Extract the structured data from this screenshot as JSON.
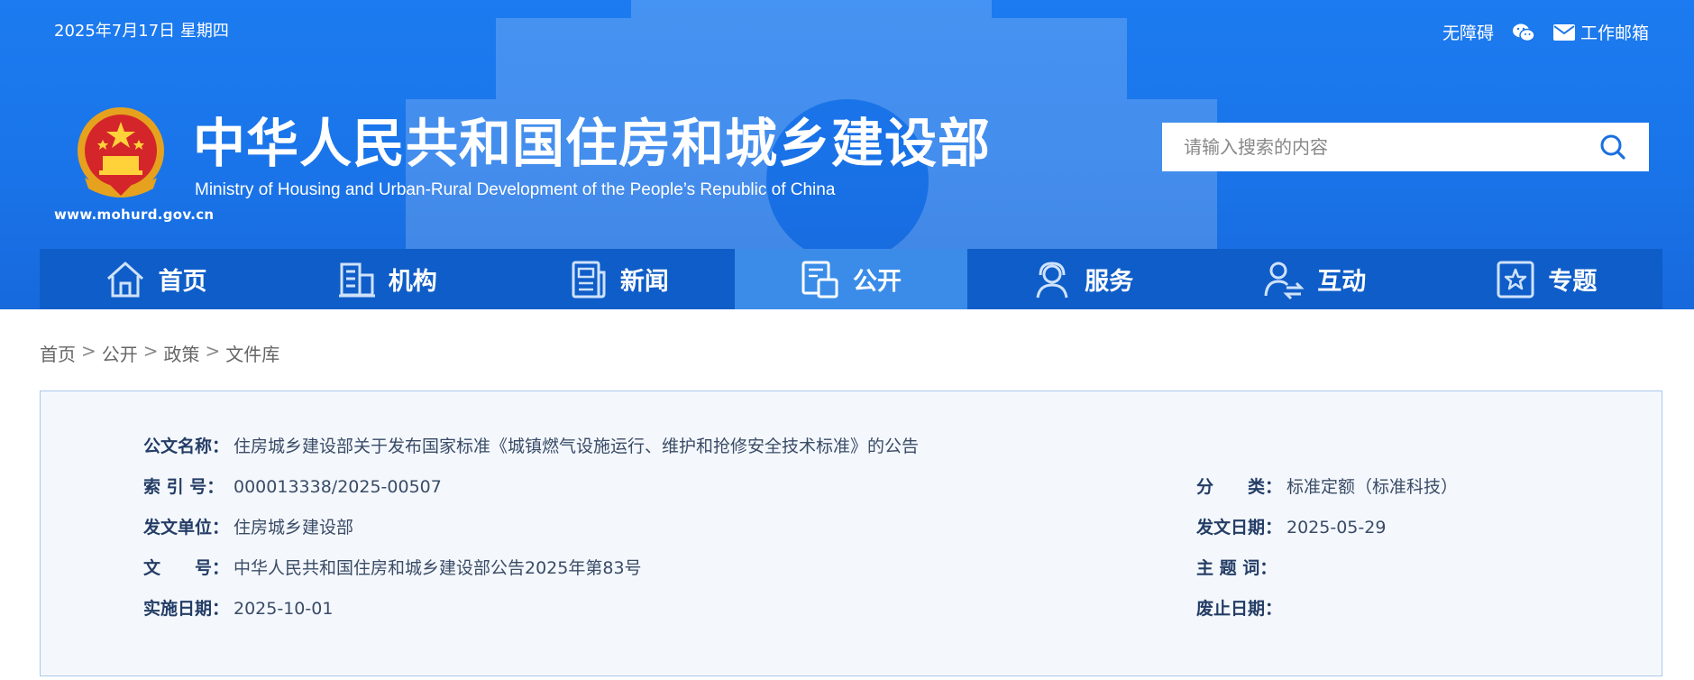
{
  "header": {
    "date": "2025年7月17日 星期四",
    "accessibility_label": "无障碍",
    "mail_label": "工作邮箱",
    "title_cn": "中华人民共和国住房和城乡建设部",
    "title_en": "Ministry of Housing and Urban-Rural Development of the People’s Republic of China",
    "domain": "www.mohurd.gov.cn",
    "search_placeholder": "请输入搜索的内容"
  },
  "nav": {
    "items": [
      {
        "label": "首页",
        "icon": "home-icon"
      },
      {
        "label": "机构",
        "icon": "building-icon"
      },
      {
        "label": "新闻",
        "icon": "newspaper-icon"
      },
      {
        "label": "公开",
        "icon": "document-icon",
        "active": true
      },
      {
        "label": "服务",
        "icon": "service-agent-icon"
      },
      {
        "label": "互动",
        "icon": "interaction-icon"
      },
      {
        "label": "专题",
        "icon": "star-topic-icon"
      }
    ]
  },
  "breadcrumb": [
    "首页",
    "公开",
    "政策",
    "文件库"
  ],
  "breadcrumb_sep": ">",
  "info": {
    "doc_name": {
      "label": "公文名称：",
      "value": "住房城乡建设部关于发布国家标准《城镇燃气设施运行、维护和抢修安全技术标准》的公告"
    },
    "index_no": {
      "label": "索 引 号：",
      "value": "000013338/2025-00507"
    },
    "category": {
      "label": "分　　类：",
      "value": "标准定额（标准科技）"
    },
    "issuer": {
      "label": "发文单位：",
      "value": "住房城乡建设部"
    },
    "issue_date": {
      "label": "发文日期：",
      "value": "2025-05-29"
    },
    "doc_no": {
      "label": "文　　号：",
      "value": "中华人民共和国住房和城乡建设部公告2025年第83号"
    },
    "keywords": {
      "label": "主 题 词：",
      "value": ""
    },
    "effective_date": {
      "label": "实施日期：",
      "value": "2025-10-01"
    },
    "abolish_date": {
      "label": "废止日期：",
      "value": ""
    }
  },
  "colors": {
    "header_blue": "#1a74e9",
    "nav_blue": "#0f5dc8",
    "nav_active": "#3a8ce8",
    "panel_bg": "#f4f8fd",
    "panel_border": "#a9c8ea",
    "label_color": "#243d66"
  }
}
